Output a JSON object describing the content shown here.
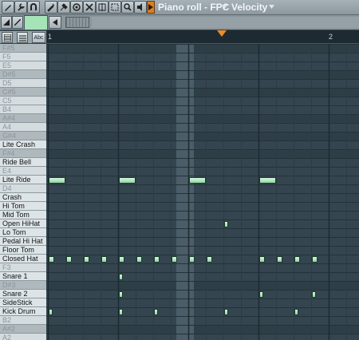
{
  "toolbar": {
    "title": "Piano roll - FPC",
    "title_sep": "–",
    "channel": "",
    "target": "Velocity",
    "tools": [
      {
        "name": "pencil-icon"
      },
      {
        "name": "wrench-icon"
      },
      {
        "name": "magnet-icon"
      },
      {
        "name": "draw-tool-icon"
      },
      {
        "name": "paint-tool-icon"
      },
      {
        "name": "delete-tool-icon"
      },
      {
        "name": "mute-tool-icon"
      },
      {
        "name": "slice-tool-icon"
      },
      {
        "name": "select-tool-icon"
      },
      {
        "name": "zoom-tool-icon"
      },
      {
        "name": "playback-tool-icon"
      }
    ]
  },
  "timeline": {
    "bars": [
      {
        "label": "1",
        "beat": 0
      },
      {
        "label": "2",
        "beat": 16
      }
    ],
    "playhead_step": 7.5
  },
  "keys": [
    {
      "label": "F#5",
      "black": true,
      "named": false
    },
    {
      "label": "F5",
      "black": false,
      "named": false
    },
    {
      "label": "E5",
      "black": false,
      "named": false
    },
    {
      "label": "D#5",
      "black": true,
      "named": false
    },
    {
      "label": "D5",
      "black": false,
      "named": false
    },
    {
      "label": "C#5",
      "black": true,
      "named": false
    },
    {
      "label": "C5",
      "black": false,
      "named": false
    },
    {
      "label": "B4",
      "black": false,
      "named": false
    },
    {
      "label": "A#4",
      "black": true,
      "named": false
    },
    {
      "label": "A4",
      "black": false,
      "named": false
    },
    {
      "label": "G#4",
      "black": true,
      "named": false
    },
    {
      "label": "Lite Crash",
      "black": false,
      "named": true
    },
    {
      "label": "F#4",
      "black": true,
      "named": false
    },
    {
      "label": "Ride Bell",
      "black": false,
      "named": true
    },
    {
      "label": "E4",
      "black": false,
      "named": false
    },
    {
      "label": "Lite Ride",
      "black": false,
      "named": true
    },
    {
      "label": "D4",
      "black": false,
      "named": false
    },
    {
      "label": "Crash",
      "black": false,
      "named": true
    },
    {
      "label": "Hi Tom",
      "black": false,
      "named": true
    },
    {
      "label": "Mid Tom",
      "black": false,
      "named": true
    },
    {
      "label": "Open HiHat",
      "black": false,
      "named": true
    },
    {
      "label": "Lo Tom",
      "black": false,
      "named": true
    },
    {
      "label": "Pedal Hi Hat",
      "black": false,
      "named": true
    },
    {
      "label": "Floor Tom",
      "black": false,
      "named": true
    },
    {
      "label": "Closed Hat",
      "black": false,
      "named": true
    },
    {
      "label": "F3",
      "black": false,
      "named": false
    },
    {
      "label": "Snare 1",
      "black": false,
      "named": true
    },
    {
      "label": "D#3",
      "black": true,
      "named": false
    },
    {
      "label": "Snare 2",
      "black": false,
      "named": true
    },
    {
      "label": "SideStick",
      "black": false,
      "named": true
    },
    {
      "label": "Kick Drum",
      "black": false,
      "named": true
    },
    {
      "label": "B2",
      "black": false,
      "named": false
    },
    {
      "label": "A#2",
      "black": true,
      "named": false
    },
    {
      "label": "A2",
      "black": false,
      "named": false
    }
  ],
  "notes": [
    {
      "row": 15,
      "step": 0,
      "len": 1
    },
    {
      "row": 15,
      "step": 4,
      "len": 1
    },
    {
      "row": 15,
      "step": 8,
      "len": 1
    },
    {
      "row": 15,
      "step": 12,
      "len": 1
    },
    {
      "row": 20,
      "step": 10,
      "len": 0.25
    },
    {
      "row": 24,
      "step": 0,
      "len": 0.35
    },
    {
      "row": 24,
      "step": 1,
      "len": 0.35
    },
    {
      "row": 24,
      "step": 2,
      "len": 0.35
    },
    {
      "row": 24,
      "step": 3,
      "len": 0.35
    },
    {
      "row": 24,
      "step": 4,
      "len": 0.35
    },
    {
      "row": 24,
      "step": 5,
      "len": 0.35
    },
    {
      "row": 24,
      "step": 6,
      "len": 0.35
    },
    {
      "row": 24,
      "step": 7,
      "len": 0.35
    },
    {
      "row": 24,
      "step": 8,
      "len": 0.35
    },
    {
      "row": 24,
      "step": 9,
      "len": 0.35
    },
    {
      "row": 24,
      "step": 12,
      "len": 0.35
    },
    {
      "row": 24,
      "step": 13,
      "len": 0.35
    },
    {
      "row": 24,
      "step": 14,
      "len": 0.35
    },
    {
      "row": 24,
      "step": 15,
      "len": 0.35
    },
    {
      "row": 26,
      "step": 4,
      "len": 0.25
    },
    {
      "row": 28,
      "step": 4,
      "len": 0.25
    },
    {
      "row": 28,
      "step": 12,
      "len": 0.25
    },
    {
      "row": 28,
      "step": 15,
      "len": 0.25
    },
    {
      "row": 30,
      "step": 0,
      "len": 0.25
    },
    {
      "row": 30,
      "step": 4,
      "len": 0.25
    },
    {
      "row": 30,
      "step": 6,
      "len": 0.25
    },
    {
      "row": 30,
      "step": 10,
      "len": 0.25
    },
    {
      "row": 30,
      "step": 14,
      "len": 0.25
    }
  ],
  "view_buttons": [
    {
      "name": "keyboard-view-button",
      "label": ""
    },
    {
      "name": "note-names-button",
      "label": ""
    },
    {
      "name": "label-abc-button",
      "label": "Abc"
    }
  ]
}
